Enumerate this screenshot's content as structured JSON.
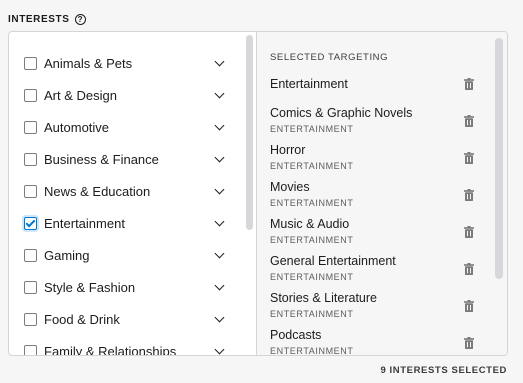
{
  "header": {
    "label": "INTERESTS",
    "help_glyph": "?"
  },
  "categories": [
    {
      "label": "Animals & Pets",
      "checked": false
    },
    {
      "label": "Art & Design",
      "checked": false
    },
    {
      "label": "Automotive",
      "checked": false
    },
    {
      "label": "Business & Finance",
      "checked": false
    },
    {
      "label": "News & Education",
      "checked": false
    },
    {
      "label": "Entertainment",
      "checked": true
    },
    {
      "label": "Gaming",
      "checked": false
    },
    {
      "label": "Style & Fashion",
      "checked": false
    },
    {
      "label": "Food & Drink",
      "checked": false
    },
    {
      "label": "Family & Relationships",
      "checked": false
    }
  ],
  "selected": {
    "title": "SELECTED TARGETING",
    "items": [
      {
        "name": "Entertainment",
        "category": ""
      },
      {
        "name": "Comics & Graphic Novels",
        "category": "ENTERTAINMENT"
      },
      {
        "name": "Horror",
        "category": "ENTERTAINMENT"
      },
      {
        "name": "Movies",
        "category": "ENTERTAINMENT"
      },
      {
        "name": "Music & Audio",
        "category": "ENTERTAINMENT"
      },
      {
        "name": "General Entertainment",
        "category": "ENTERTAINMENT"
      },
      {
        "name": "Stories & Literature",
        "category": "ENTERTAINMENT"
      },
      {
        "name": "Podcasts",
        "category": "ENTERTAINMENT"
      }
    ]
  },
  "footer": {
    "count_text": "9 INTERESTS SELECTED"
  },
  "colors": {
    "accent": "#0079d3",
    "border": "#d4d5d8",
    "panel_bg": "#f6f6f7"
  },
  "icons": {
    "help": "help-circle-icon",
    "expand": "chevron-down-icon",
    "remove": "trash-icon"
  }
}
